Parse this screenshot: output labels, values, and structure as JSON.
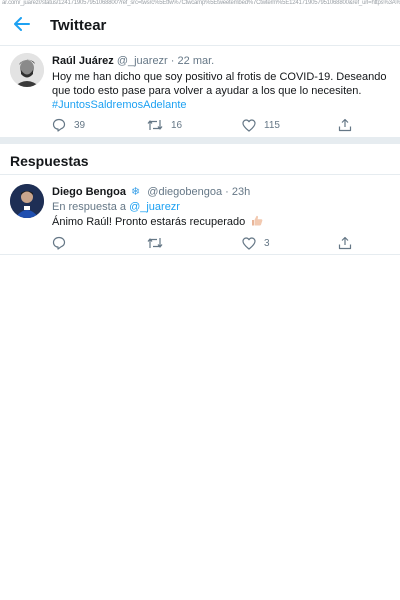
{
  "browser": {
    "url": "ar.com/_juarezr/status/1241719057951068800?ref_src=twsrc%5Etfw%7Ctwcamp%5Etweetembed%7Ctwterm%5E1241719057951068800&ref_url=https%3A%2F"
  },
  "header": {
    "title": "Twittear"
  },
  "main_tweet": {
    "name": "Raúl Juárez",
    "handle": "@_juarezr",
    "separator": "·",
    "time": "22 mar.",
    "text": "Hoy me han dicho que soy positivo al frotis de COVID-19. Deseando que todo esto pase para volver a ayudar a los que lo necesiten.",
    "hashtag": "#JuntosSaldremosAdelante",
    "replies": "39",
    "retweets": "16",
    "likes": "115"
  },
  "replies_section": {
    "title": "Respuestas"
  },
  "reply": {
    "name": "Diego Bengoa",
    "badge": "❄",
    "handle": "@diegobengoa",
    "separator": "·",
    "time": "23h",
    "reply_to_label": "En respuesta a",
    "reply_to_handle": "@_juarezr",
    "text": "Ánimo Raúl! Pronto estarás recuperado",
    "likes": "3"
  },
  "colors": {
    "accent": "#1da1f2",
    "text": "#14171a",
    "muted": "#657786",
    "divider": "#e6ecf0"
  },
  "icons": [
    "back-arrow-icon",
    "reply-icon",
    "retweet-icon",
    "like-icon",
    "share-icon",
    "snowflake-icon",
    "thumbs-up-emoji"
  ]
}
